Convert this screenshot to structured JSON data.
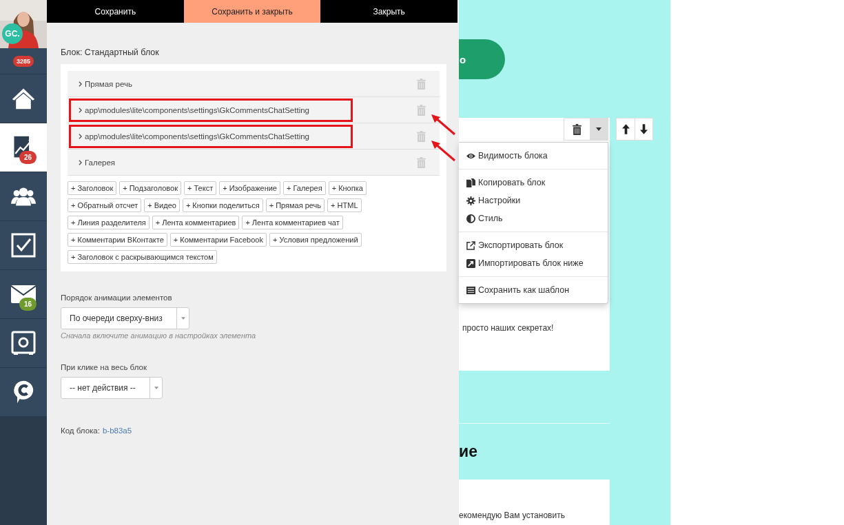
{
  "sidebar": {
    "avatar": {
      "kind": "picture",
      "badge": "GC."
    },
    "counter": "3285",
    "items": [
      {
        "kind": "home",
        "selected": false
      },
      {
        "kind": "chart",
        "selected": true,
        "badge": "26",
        "color": "#d33b34"
      },
      {
        "kind": "users",
        "selected": false
      },
      {
        "kind": "tasks",
        "selected": false
      },
      {
        "kind": "mail",
        "selected": false,
        "badge": "16",
        "color": "#6f9a2e"
      },
      {
        "kind": "safe",
        "selected": false
      },
      {
        "kind": "chat",
        "selected": false
      }
    ]
  },
  "toolbar": [
    {
      "label": "Сохранить",
      "selected": false
    },
    {
      "label": "Сохранить и закрыть",
      "selected": true
    },
    {
      "label": "Закрыть",
      "selected": false
    }
  ],
  "block_title": "Блок: Стандартный блок",
  "elements": [
    {
      "label": "Прямая речь",
      "highlighted": false
    },
    {
      "label": "app\\modules\\lite\\components\\settings\\GkCommentsChatSetting",
      "highlighted": true
    },
    {
      "label": "app\\modules\\lite\\components\\settings\\GkCommentsChatSetting",
      "highlighted": true
    },
    {
      "label": "Галерея",
      "highlighted": false
    }
  ],
  "add_buttons": [
    [
      "+ Заголовок",
      "+ Подзаголовок",
      "+ Текст",
      "+ Изображение",
      "+ Галерея",
      "+ Кнопка"
    ],
    [
      "+ Обратный отсчет",
      "+ Видео",
      "+ Кнопки поделиться",
      "+ Прямая речь",
      "+ HTML"
    ],
    [
      "+ Линия разделителя",
      "+ Лента комментариев",
      "+ Лента комментариев чат"
    ],
    [
      "+ Комментарии ВКонтакте",
      "+ Комментарии Facebook",
      "+ Условия предложений"
    ],
    [
      "+ Заголовок с раскрывающимся текстом"
    ]
  ],
  "animation_order": {
    "label": "Порядок анимации элементов",
    "value": "По очереди сверху-вниз",
    "hint": "Сначала включите анимацию в настройках элемента"
  },
  "click_action": {
    "label": "При клике на весь блок",
    "value": "-- нет действия --"
  },
  "block_code": {
    "label": "Код блока:",
    "value": "b-b83a5"
  },
  "preview": {
    "button_label": "о",
    "menu": [
      [
        {
          "kind": "eye",
          "label": "Видимость блока"
        }
      ],
      [
        {
          "kind": "copy",
          "label": "Копировать блок"
        },
        {
          "kind": "gear",
          "label": "Настройки"
        },
        {
          "kind": "contrast",
          "label": "Стиль"
        }
      ],
      [
        {
          "kind": "export",
          "label": "Экспортировать блок"
        },
        {
          "kind": "import",
          "label": "Импортировать блок ниже"
        }
      ],
      [
        {
          "kind": "list",
          "label": "Сохранить как шаблон"
        }
      ]
    ],
    "card_text": "просто наших секретах!",
    "heading": "ие",
    "paragraph": "екомендую Вам установить"
  }
}
